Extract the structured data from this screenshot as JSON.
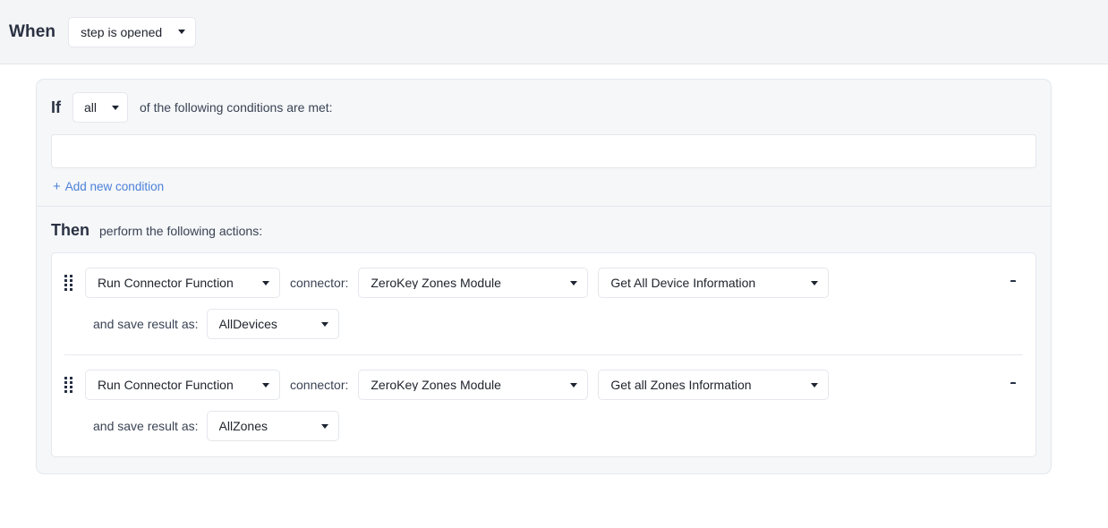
{
  "trigger": {
    "keyword": "When",
    "selected": "step is opened"
  },
  "condition_block": {
    "keyword": "If",
    "match_mode": "all",
    "lead_text": "of the following conditions are met:",
    "conditions": [],
    "add_condition_label": "Add new condition",
    "add_condition_plus": "+"
  },
  "action_block": {
    "keyword": "Then",
    "lead_text": "perform the following actions:",
    "connector_label": "connector:",
    "save_label": "and save result as:",
    "actions": [
      {
        "type": "Run Connector Function",
        "connector": "ZeroKey Zones Module",
        "operation": "Get All Device Information",
        "save_as": "AllDevices",
        "delete_icon": "trash-icon",
        "drag_icon": "drag-handle-icon"
      },
      {
        "type": "Run Connector Function",
        "connector": "ZeroKey Zones Module",
        "operation": "Get all Zones Information",
        "save_as": "AllZones",
        "delete_icon": "trash-icon",
        "drag_icon": "drag-handle-icon"
      }
    ]
  },
  "colors": {
    "link": "#4c80d8",
    "heading": "#2a3142",
    "panel_bg": "#f5f7f9",
    "header_bg": "#f4f5f7",
    "border": "#e4e7ec",
    "icon": "#273043"
  }
}
